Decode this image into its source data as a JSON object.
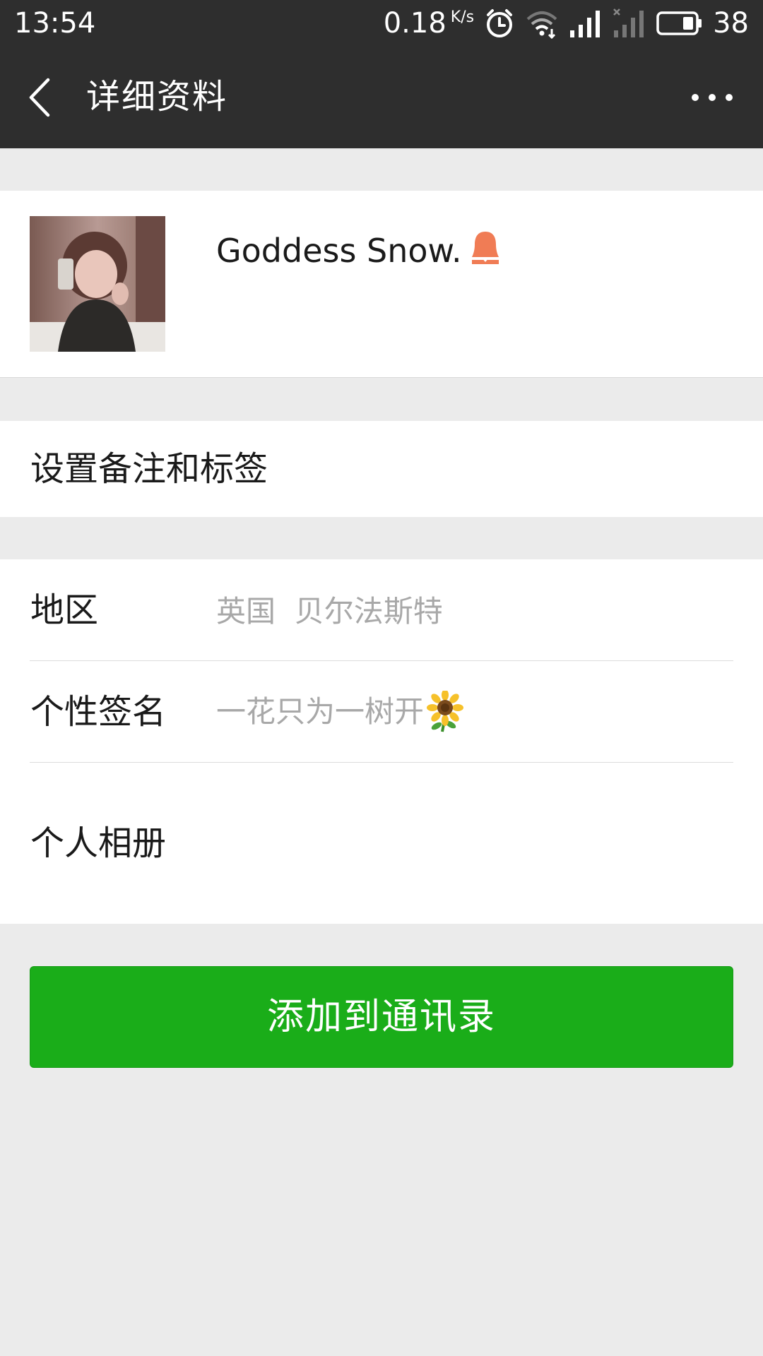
{
  "status_bar": {
    "time": "13:54",
    "net_speed": "0.18",
    "net_speed_unit": "K/s",
    "battery_level": "38",
    "icons": [
      "alarm-icon",
      "wifi-icon",
      "signal-icon",
      "signal-no-sim-icon",
      "battery-icon"
    ]
  },
  "app_bar": {
    "title": "详细资料",
    "back_icon": "chevron-left-icon",
    "more_icon": "more-horizontal-icon"
  },
  "profile": {
    "name": "Goddess Snow.",
    "gender_icon": "female-icon",
    "gender_color": "#f07c55"
  },
  "remark": {
    "label": "设置备注和标签"
  },
  "info": {
    "region_label": "地区",
    "region_value": "英国  贝尔法斯特",
    "signature_label": "个性签名",
    "signature_value": "一花只为一树开",
    "signature_emoji": "sunflower-icon",
    "album_label": "个人相册"
  },
  "actions": {
    "add_contact_label": "添加到通讯录",
    "accent_color": "#1aad19"
  }
}
